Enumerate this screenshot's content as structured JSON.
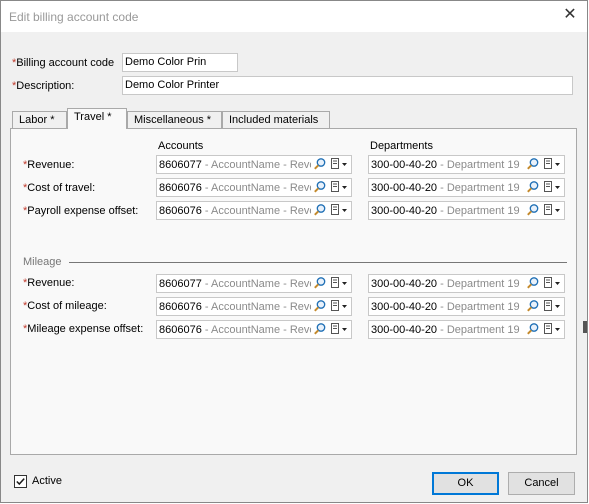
{
  "dialog": {
    "title": "Edit billing account code",
    "close_icon": "close-icon"
  },
  "header_fields": {
    "billing_code": {
      "label": "Billing account code",
      "value": "Demo Color Prin",
      "required": true
    },
    "description": {
      "label": "Description:",
      "value": "Demo Color Printer",
      "required": true
    }
  },
  "tabs": [
    {
      "label": "Labor *",
      "active": false
    },
    {
      "label": "Travel *",
      "active": true
    },
    {
      "label": "Miscellaneous *",
      "active": false
    },
    {
      "label": "Included materials",
      "active": false
    }
  ],
  "columns": {
    "accounts": "Accounts",
    "departments": "Departments"
  },
  "travel_rows": [
    {
      "label": "Revenue:",
      "account_code": "8606077",
      "account_hint": " - AccountName - Revenue",
      "dept_code": "300-00-40-20",
      "dept_hint": " - Department 19"
    },
    {
      "label": "Cost of travel:",
      "account_code": "8606076",
      "account_hint": " - AccountName - Revenue",
      "dept_code": "300-00-40-20",
      "dept_hint": " - Department 19"
    },
    {
      "label": "Payroll expense offset:",
      "account_code": "8606076",
      "account_hint": " - AccountName - Revenue",
      "dept_code": "300-00-40-20",
      "dept_hint": " - Department 19"
    }
  ],
  "mileage": {
    "title": "Mileage",
    "rows": [
      {
        "label": "Revenue:",
        "account_code": "8606077",
        "account_hint": " - AccountName - Revenue",
        "dept_code": "300-00-40-20",
        "dept_hint": " - Department 19"
      },
      {
        "label": "Cost of mileage:",
        "account_code": "8606076",
        "account_hint": " - AccountName - Revenue",
        "dept_code": "300-00-40-20",
        "dept_hint": " - Department 19"
      },
      {
        "label": "Mileage expense offset:",
        "account_code": "8606076",
        "account_hint": " - AccountName - Revenue",
        "dept_code": "300-00-40-20",
        "dept_hint": " - Department 19"
      }
    ]
  },
  "footer": {
    "active_label": "Active",
    "active_checked": true,
    "ok_label": "OK",
    "cancel_label": "Cancel"
  },
  "colors": {
    "required_asterisk": "#c0392b",
    "hint_text": "#8a8a8a",
    "default_button_border": "#0078d7",
    "magnifier": "#1f6fb5"
  }
}
